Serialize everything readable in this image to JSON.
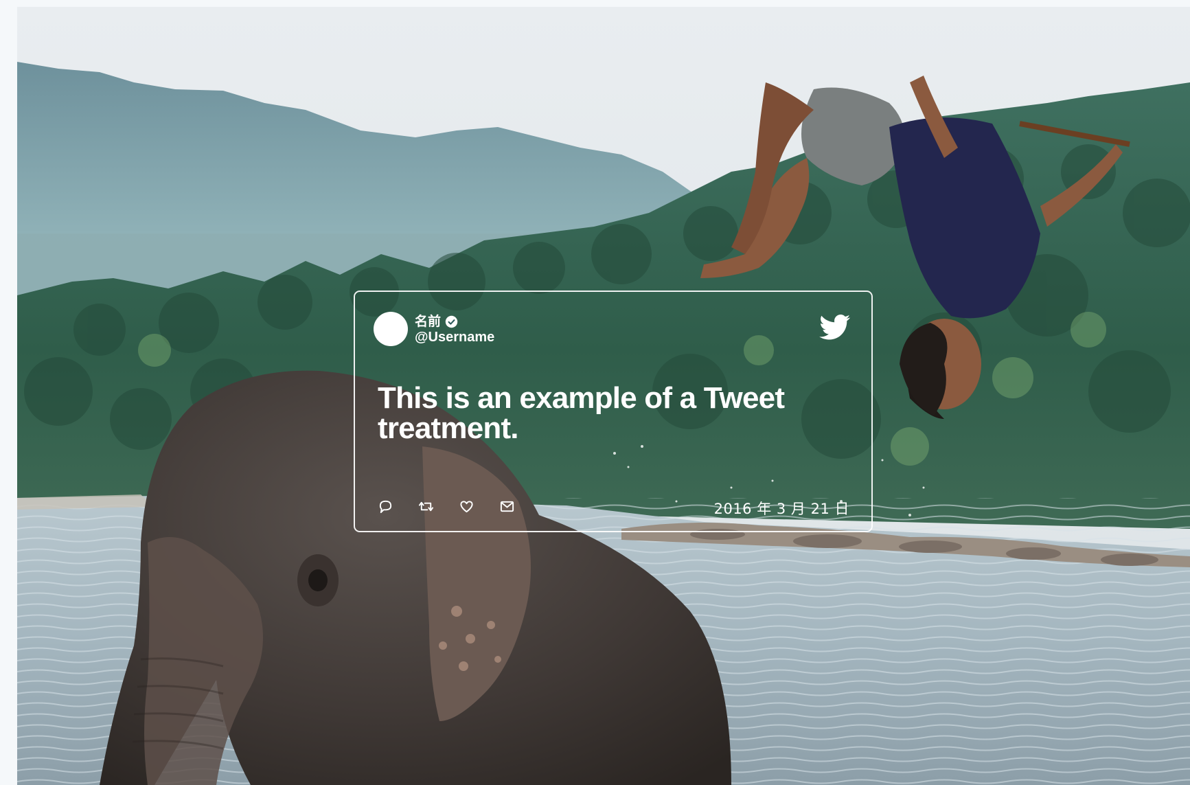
{
  "tweet": {
    "display_name": "名前",
    "username": "@Username",
    "text": "This is an example of a Tweet treatment.",
    "timestamp": "2016 年 3 月 21 日",
    "actions": [
      {
        "icon": "reply-icon"
      },
      {
        "icon": "retweet-icon"
      },
      {
        "icon": "like-icon"
      },
      {
        "icon": "direct-message-icon"
      }
    ]
  },
  "icons": {
    "brand": "twitter-bird-icon",
    "verified": "verified-badge-icon"
  },
  "colors": {
    "card_foreground": "#ffffff",
    "page_background": "#f5f8fa"
  }
}
